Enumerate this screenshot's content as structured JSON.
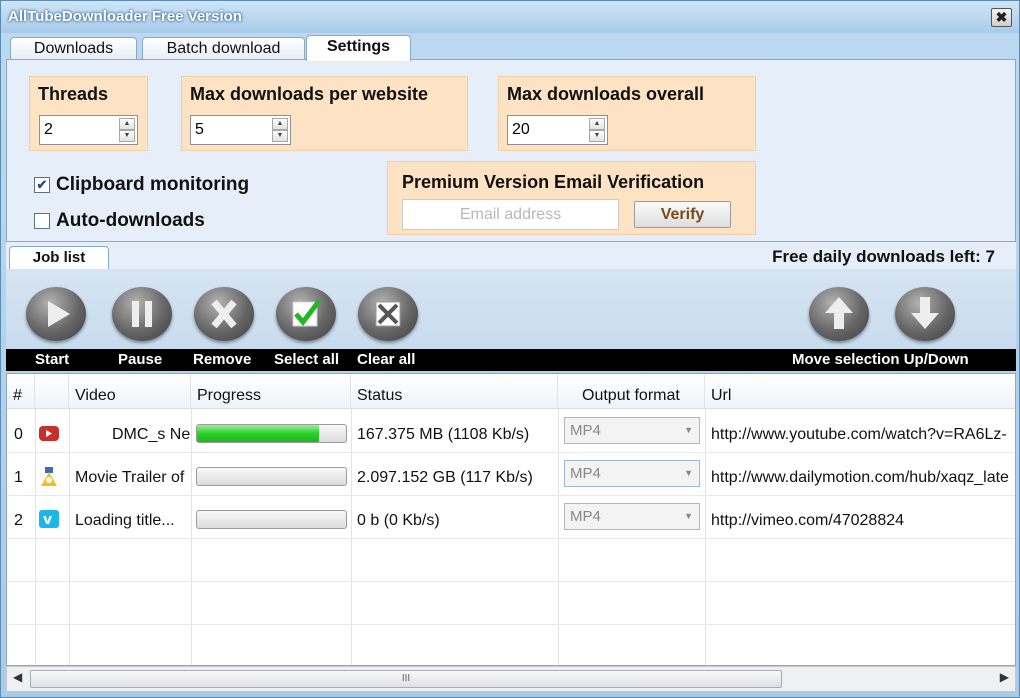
{
  "window": {
    "title": "AllTubeDownloader Free Version",
    "close_glyph": "✖"
  },
  "tabs": [
    {
      "label": "Downloads"
    },
    {
      "label": "Batch download"
    },
    {
      "label": "Settings",
      "active": true
    }
  ],
  "settings": {
    "threads": {
      "label": "Threads",
      "value": "2"
    },
    "max_per_website": {
      "label": "Max downloads per website",
      "value": "5"
    },
    "max_overall": {
      "label": "Max downloads overall",
      "value": "20"
    },
    "clipboard_monitoring": {
      "label": "Clipboard monitoring",
      "checked": true
    },
    "auto_downloads": {
      "label": "Auto-downloads",
      "checked": false
    },
    "premium": {
      "title": "Premium Version Email Verification",
      "email_placeholder": "Email address",
      "verify_label": "Verify"
    }
  },
  "joblist": {
    "tab_label": "Job list",
    "free_left": "Free daily downloads left: 7"
  },
  "toolbar": {
    "buttons": [
      {
        "label": "Start",
        "icon": "play-icon"
      },
      {
        "label": "Pause",
        "icon": "pause-icon"
      },
      {
        "label": "Remove",
        "icon": "remove-icon"
      },
      {
        "label": "Select all",
        "icon": "select-all-icon"
      },
      {
        "label": "Clear all",
        "icon": "clear-all-icon"
      }
    ],
    "move_label": "Move selection Up/Down",
    "up_icon": "arrow-up-icon",
    "down_icon": "arrow-down-icon"
  },
  "table": {
    "headers": [
      "#",
      "",
      "Video",
      "Progress",
      "Status",
      "Output format",
      "Url"
    ],
    "rows": [
      {
        "index": "0",
        "icon": "youtube-icon",
        "video": "DMC_s Ne",
        "progress": 0.82,
        "status": "167.375 MB (1108 Kb/s)",
        "format": "MP4",
        "url": "http://www.youtube.com/watch?v=RA6Lz-"
      },
      {
        "index": "1",
        "icon": "dailymotion-icon",
        "video": "Movie Trailer of",
        "progress": 0.0,
        "status": "2.097.152 GB (117 Kb/s)",
        "format": "MP4",
        "url": "http://www.dailymotion.com/hub/xaqz_late"
      },
      {
        "index": "2",
        "icon": "vimeo-icon",
        "video": "Loading title...",
        "progress": 0.0,
        "status": "0 b (0 Kb/s)",
        "format": "MP4",
        "url": "http://vimeo.com/47028824"
      }
    ]
  },
  "scrollbar": {
    "grip": "III"
  }
}
